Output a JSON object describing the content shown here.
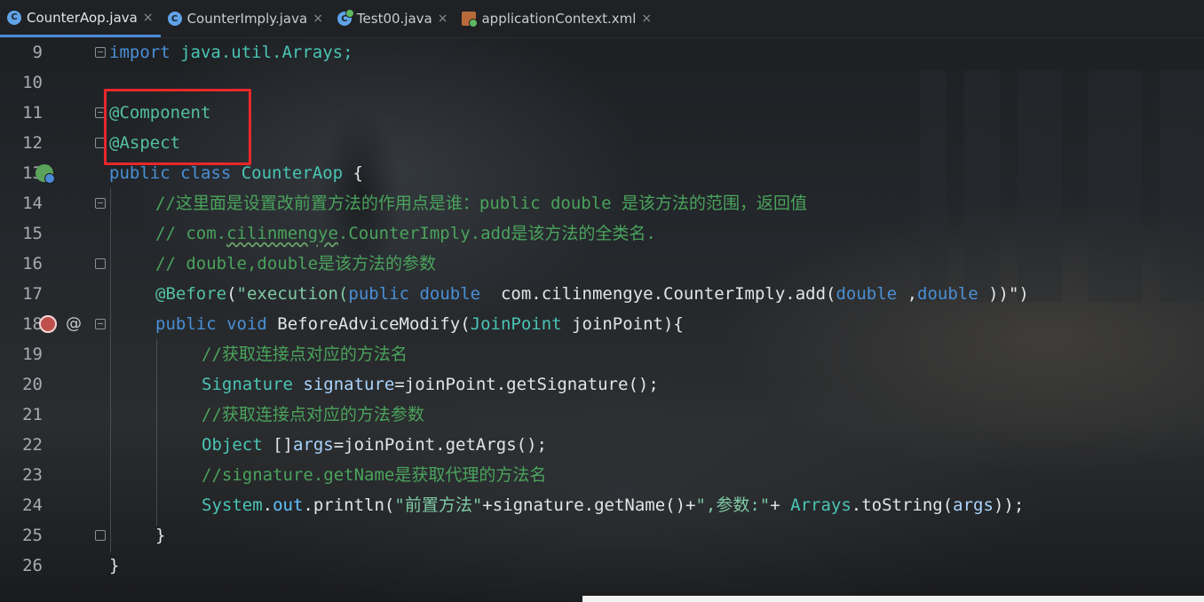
{
  "tabs": [
    {
      "label": "CounterAop.java",
      "icon": "java-class-icon",
      "active": true
    },
    {
      "label": "CounterImply.java",
      "icon": "java-class-icon",
      "active": false
    },
    {
      "label": "Test00.java",
      "icon": "java-test-class-icon",
      "active": false
    },
    {
      "label": "applicationContext.xml",
      "icon": "xml-file-icon",
      "active": false
    }
  ],
  "tab_close_glyph": "×",
  "line_numbers": [
    "9",
    "10",
    "11",
    "12",
    "13",
    "14",
    "15",
    "16",
    "17",
    "18",
    "19",
    "20",
    "21",
    "22",
    "23",
    "24",
    "25",
    "26"
  ],
  "code": {
    "l9": {
      "kw": "import",
      "rest": " java.util.Arrays;"
    },
    "l11": {
      "ann": "@Component"
    },
    "l12": {
      "ann": "@Aspect"
    },
    "l13": {
      "kw1": "public",
      "kw2": " class ",
      "name": "CounterAop",
      "rest": " {"
    },
    "l14": {
      "comment": "//这里面是设置改前置方法的作用点是谁：public double 是该方法的范围，返回值"
    },
    "l15": {
      "c1": "// com.",
      "c2": "cilinmengye",
      "c3": ".CounterImply.add是该方法的全类名."
    },
    "l16": {
      "comment": "// double,double是该方法的参数"
    },
    "l17": {
      "ann": "@Before",
      "p1": "(",
      "s1": "\"execution(",
      "k1": "public",
      "sp1": " ",
      "k2": "double",
      "s2": "  com.cilinmengye.CounterImply.add(",
      "k3": "double",
      "s3": " ,",
      "k4": "double",
      "s4": " ))\"",
      "p2": ")"
    },
    "l18": {
      "k1": "public",
      "k2": " void ",
      "name": "BeforeAdviceModify",
      "p1": "(",
      "type": "JoinPoint",
      "arg": " joinPoint",
      "p2": "){"
    },
    "l19": {
      "comment": "//获取连接点对应的方法名"
    },
    "l20": {
      "type": "Signature",
      "var": " signature",
      "rest": "=joinPoint.getSignature();"
    },
    "l21": {
      "comment": "//获取连接点对应的方法参数"
    },
    "l22": {
      "type": "Object",
      "rest1": " []",
      "var": "args",
      "rest2": "=joinPoint.getArgs();"
    },
    "l23": {
      "comment": "//signature.getName是获取代理的方法名"
    },
    "l24": {
      "cls": "System",
      "dot1": ".",
      "field": "out",
      "r1": ".println(",
      "str1": "\"前置方法\"",
      "r2": "+signature.getName()+",
      "str2": "\",参数:\"",
      "r3": "+ ",
      "cls2": "Arrays",
      "r4": ".toString(",
      "var": "args",
      "r5": "));"
    },
    "l25": {
      "rest": "}"
    },
    "l26": {
      "rest": "}"
    }
  },
  "gutter_icons": {
    "line13": "spring-bean-icon",
    "line18_a": "aspect-advice-icon",
    "line18_b": "@"
  },
  "colors": {
    "keyword": "#4a8fd6",
    "annotation": "#54c0a0",
    "comment": "#4aa35c",
    "highlight_box": "#e8282a",
    "active_tab_underline": "#4a8ad8"
  }
}
